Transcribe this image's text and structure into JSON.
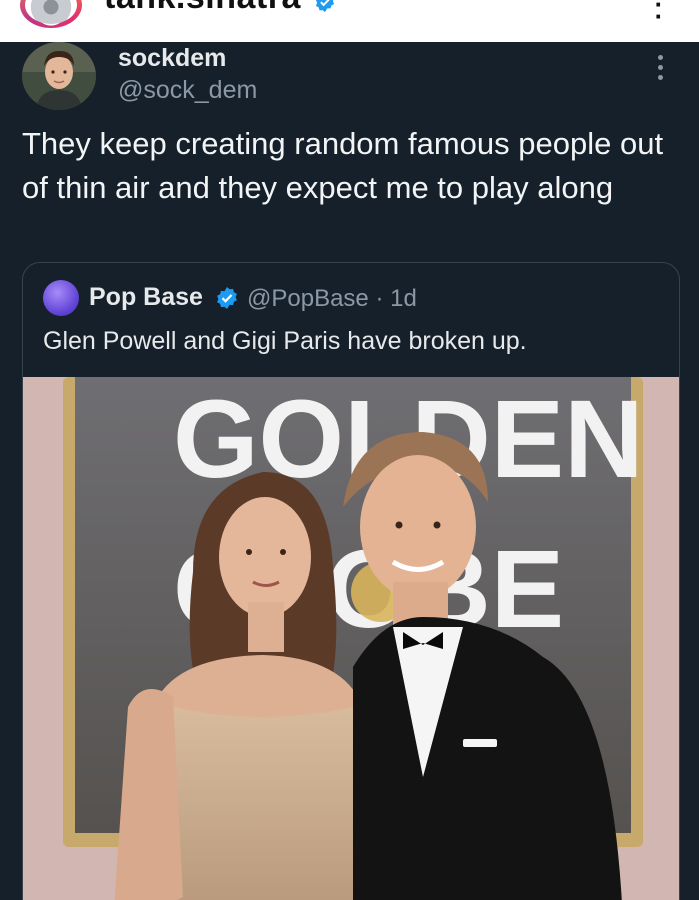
{
  "ig_header": {
    "username": "tank.sinatra"
  },
  "tweet": {
    "display_name": "sockdem",
    "handle": "@sock_dem",
    "text": "They keep creating random famous people out of thin air and they expect me to play along"
  },
  "quote": {
    "display_name": "Pop Base",
    "handle_time": "@PopBase · 1d",
    "text": "Glen Powell and Gigi Paris have broken up.",
    "photo_backdrop_text": [
      "GOLDEN",
      "GLOBE"
    ]
  },
  "colors": {
    "background": "#15202b",
    "text_primary": "#e7e9ea",
    "text_secondary": "#8b98a5",
    "verified_blue": "#1d9bf0",
    "card_border": "#38444d"
  },
  "icons": [
    "verified-badge-icon",
    "more-options-icon"
  ]
}
